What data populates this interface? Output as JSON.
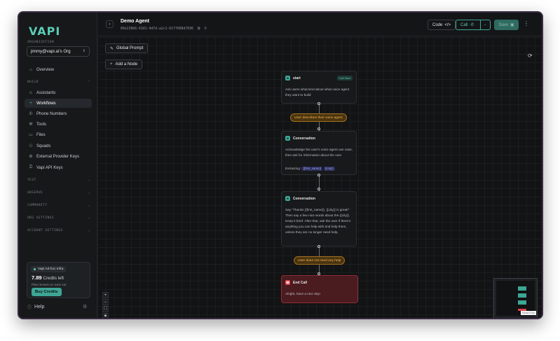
{
  "sidebar": {
    "logo": "VAPI",
    "org_label": "ORGANIZATION",
    "org_value": "jimmy@vapi.ai's Org",
    "overview": "Overview",
    "build_label": "BUILD",
    "items": [
      {
        "label": "Assistants",
        "icon": "robot-icon"
      },
      {
        "label": "Workflows",
        "icon": "workflow-icon"
      },
      {
        "label": "Phone Numbers",
        "icon": "phone-icon"
      },
      {
        "label": "Tools",
        "icon": "wrench-icon"
      },
      {
        "label": "Files",
        "icon": "folder-icon"
      },
      {
        "label": "Squads",
        "icon": "squads-icon"
      },
      {
        "label": "External Provider Keys",
        "icon": "gear-icon"
      },
      {
        "label": "Vapi API Keys",
        "icon": "key-icon"
      }
    ],
    "groups": [
      "TEST",
      "OBSERVE",
      "COMMUNITY",
      "ORG SETTINGS",
      "ACCOUNT SETTINGS"
    ],
    "plan_badge": "Vapi Ad-hoc Infra",
    "credits_value": "7.89",
    "credits_label": "Credits left",
    "plan_renew": "Plan renews on June 1st",
    "buy_credits": "Buy Credits",
    "help": "Help"
  },
  "topbar": {
    "title": "Demo Agent",
    "agent_id": "66e238b6-63d1-4d7d-a2c1-617f688d7696",
    "code_label": "Code",
    "call_label": "Call",
    "save_label": "Save"
  },
  "canvas": {
    "global_prompt": "Global Prompt",
    "add_node": "Add a Node",
    "nodes": [
      {
        "title": "start",
        "badge": "Call Start",
        "text": "Ask users what kind about what voice agent they want to build"
      },
      {
        "title": "Conversation",
        "text": "Acknowledge the user's voice agent use case, then ask for information about the user",
        "extracting_label": "Extracting:",
        "vars": [
          "{{first_name}}",
          "{{city}}"
        ]
      },
      {
        "title": "Conversation",
        "text": "Say \"Thanks {{first_name}}, {{city}} is great!\" Then say a few nice words about the {{city}}. Keep it brief. After that, ask the user if there's anything you can help with and help them, unless they are no longer need help."
      },
      {
        "title": "End Call",
        "text": "Alright, have a nice day!"
      }
    ],
    "conditions": [
      "User describes their voice agent",
      "User does not need any help"
    ]
  },
  "watermark": "React Flow",
  "colors": {
    "accent": "#5ccbb6",
    "end_node": "#e0444f",
    "condition": "#f0b44c"
  }
}
